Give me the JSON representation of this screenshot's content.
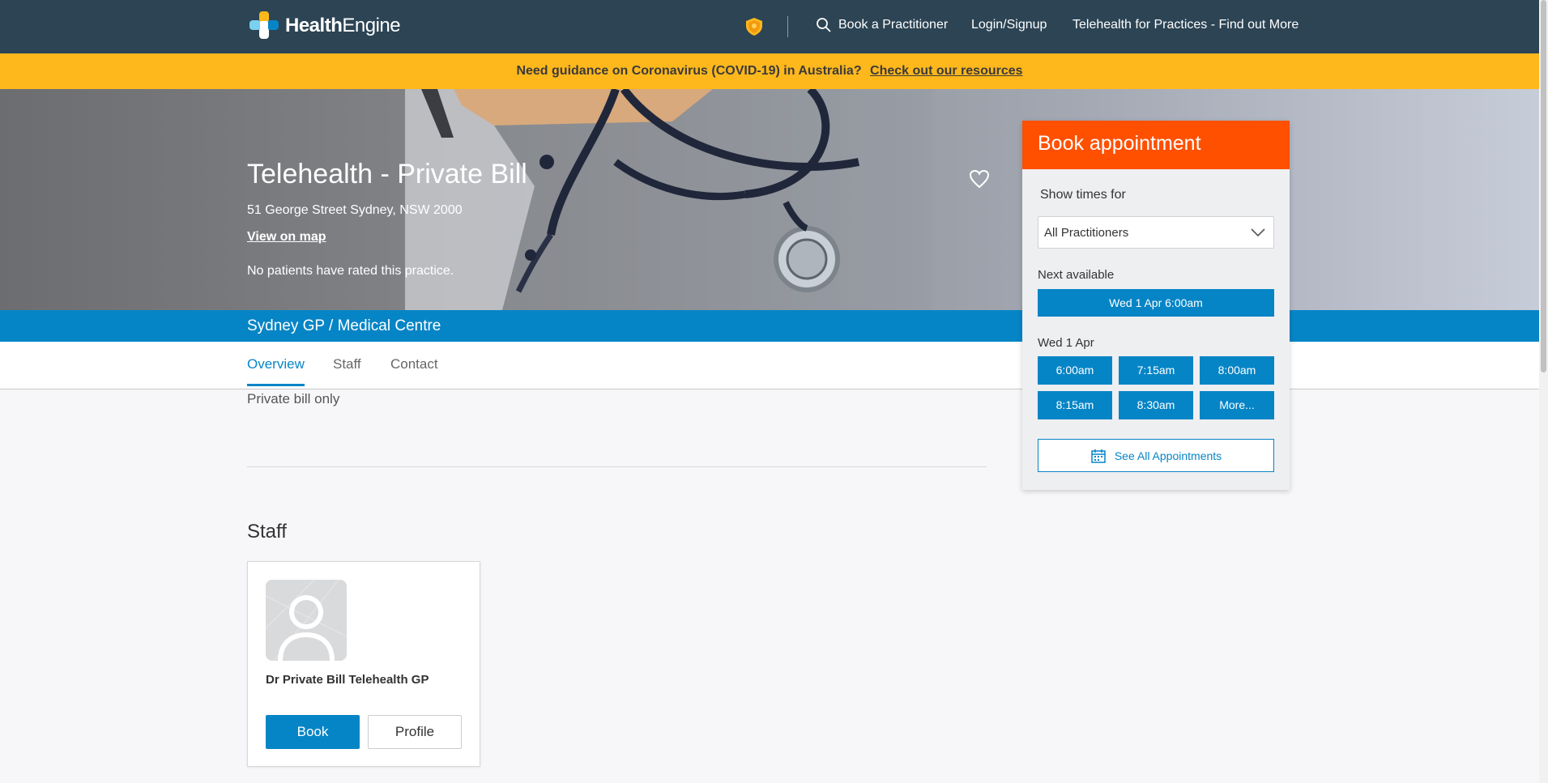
{
  "nav": {
    "brand": "HealthEngine",
    "brand_bold": "Health",
    "brand_light": "Engine",
    "book_link": "Book a Practitioner",
    "login_link": "Login/Signup",
    "telehealth_link": "Telehealth for Practices - Find out More",
    "icons": [
      "shield-icon",
      "search-icon"
    ]
  },
  "banner": {
    "text": "Need guidance on Coronavirus (COVID-19) in Australia?",
    "link": "Check out our resources",
    "color": "#ffb81c"
  },
  "practice": {
    "name": "Telehealth - Private Bill",
    "address": "51 George Street Sydney, NSW 2000",
    "map_link": "View on map",
    "rating_text": "No patients have rated this practice.",
    "category": "Sydney GP / Medical Centre"
  },
  "tabs": [
    "Overview",
    "Staff",
    "Contact"
  ],
  "active_tab": "Overview",
  "overview": {
    "billing": "Private bill only"
  },
  "staff": {
    "heading": "Staff",
    "members": [
      {
        "name": "Dr Private Bill Telehealth GP",
        "book_label": "Book",
        "profile_label": "Profile"
      }
    ]
  },
  "booking": {
    "title": "Book appointment",
    "show_times_label": "Show times for",
    "practitioner_select": "All Practitioners",
    "next_available_label": "Next available",
    "next_available": "Wed 1 Apr 6:00am",
    "date_label": "Wed 1 Apr",
    "slots": [
      "6:00am",
      "7:15am",
      "8:00am",
      "8:15am",
      "8:30am",
      "More..."
    ],
    "see_all": "See All Appointments",
    "header_color": "#ff5000",
    "accent_color": "#0685c6"
  }
}
